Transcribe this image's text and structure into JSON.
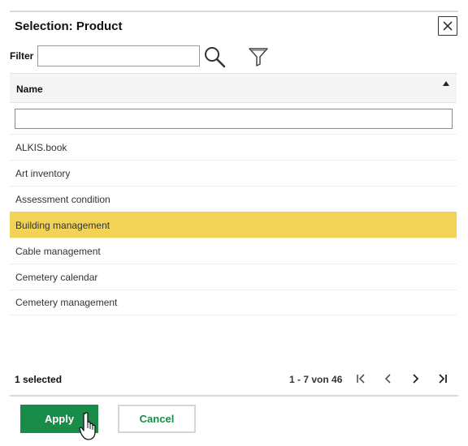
{
  "dialog": {
    "title": "Selection: Product",
    "close_icon": "close-icon"
  },
  "filter": {
    "label": "Filter",
    "value": "",
    "placeholder": "",
    "search_icon": "search-icon",
    "funnel_icon": "funnel-icon"
  },
  "grid": {
    "column_name": "Name",
    "sort_icon": "sort-ascending-icon",
    "column_filter_value": "",
    "rows": [
      {
        "name": "ALKIS.book",
        "selected": false
      },
      {
        "name": "Art inventory",
        "selected": false
      },
      {
        "name": "Assessment condition",
        "selected": false
      },
      {
        "name": "Building management",
        "selected": true
      },
      {
        "name": "Cable management",
        "selected": false
      },
      {
        "name": "Cemetery calendar",
        "selected": false
      },
      {
        "name": "Cemetery management",
        "selected": false
      }
    ]
  },
  "footer": {
    "selected_count": "1 selected",
    "page_range": "1 - 7 von 46"
  },
  "actions": {
    "apply_label": "Apply",
    "cancel_label": "Cancel"
  },
  "colors": {
    "selected_row": "#f2d355",
    "primary_button": "#1a8c4a"
  }
}
